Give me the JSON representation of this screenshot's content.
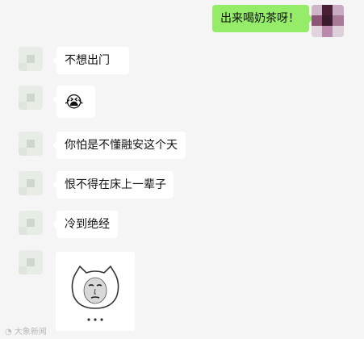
{
  "messages": [
    {
      "side": "right",
      "text": "出来喝奶茶呀！"
    },
    {
      "side": "left",
      "text": "不想出门"
    },
    {
      "side": "left",
      "emoji": "😭"
    },
    {
      "side": "left",
      "text": "你怕是不懂融安这个天"
    },
    {
      "side": "left",
      "text": "恨不得在床上一辈子"
    },
    {
      "side": "left",
      "text": "冷到绝经"
    },
    {
      "side": "left",
      "sticker": "cat-face-sticker"
    }
  ],
  "colors": {
    "background": "#f5f5f5",
    "bubble_left": "#ffffff",
    "bubble_right": "#95ec69"
  },
  "watermark": "大象新闻"
}
